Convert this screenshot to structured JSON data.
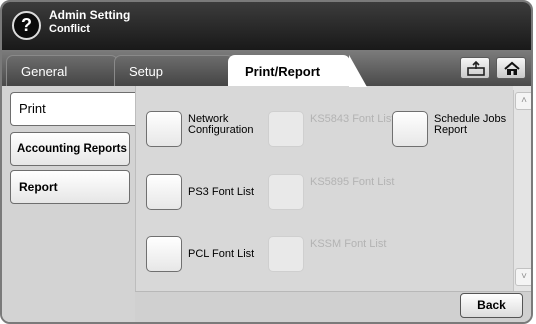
{
  "header": {
    "help_icon": "?",
    "title": "Admin Setting",
    "subtitle": "Conflict"
  },
  "tabs": [
    {
      "label": "General"
    },
    {
      "label": "Setup"
    },
    {
      "label": "Print/Report"
    }
  ],
  "toolbar_icons": [
    "tray-icon",
    "home-icon"
  ],
  "menu": {
    "items": [
      {
        "label": "Print"
      },
      {
        "label": "Accounting Reports"
      },
      {
        "label": "Report"
      }
    ]
  },
  "options": {
    "network_configuration": "Network Configuration",
    "ks5843_font_list": "KS5843 Font List",
    "schedule_jobs_report": "Schedule Jobs Report",
    "ps3_font_list": "PS3 Font List",
    "ks5895_font_list": "KS5895 Font List",
    "pcl_font_list": "PCL Font List",
    "kssm_font_list": "KSSM Font List"
  },
  "scroll": {
    "up": "˄",
    "down": "˅"
  },
  "footer": {
    "back_label": "Back"
  },
  "colors": {
    "header_bg": "#1f1f1f",
    "active_tab": "#ffffff",
    "disabled_text": "#b3b3b3"
  }
}
